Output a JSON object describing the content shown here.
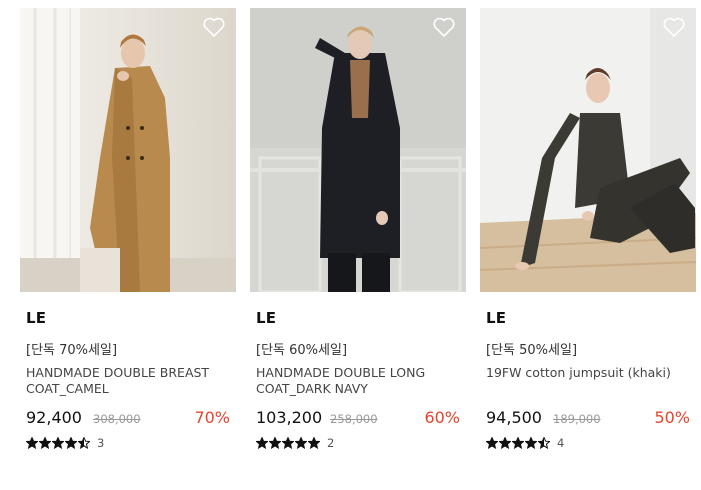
{
  "products": [
    {
      "brand": "LE",
      "promo": "[단독 70%세일]",
      "name_line1": "HANDMADE DOUBLE BREAST",
      "name_line2": "COAT_CAMEL",
      "price": "92,400",
      "original_price": "308,000",
      "discount": "70%",
      "rating": 4.5,
      "review_count": "3",
      "image": "woman-in-camel-coat-photo",
      "wish_icon": "heart-outline-icon"
    },
    {
      "brand": "LE",
      "promo": "[단독 60%세일]",
      "name_line1": "HANDMADE DOUBLE LONG",
      "name_line2": "COAT_DARK NAVY",
      "price": "103,200",
      "original_price": "258,000",
      "discount": "60%",
      "rating": 5,
      "review_count": "2",
      "image": "woman-in-dark-navy-coat-photo",
      "wish_icon": "heart-outline-icon"
    },
    {
      "brand": "LE",
      "promo": "[단독 50%세일]",
      "name_line1": "19FW cotton jumpsuit (khaki)",
      "name_line2": "",
      "price": "94,500",
      "original_price": "189,000",
      "discount": "50%",
      "rating": 4.5,
      "review_count": "4",
      "image": "woman-in-khaki-jumpsuit-photo",
      "wish_icon": "heart-outline-icon"
    }
  ],
  "colors": {
    "discount": "#e8442c",
    "original_price": "#999999",
    "star": "#111111"
  }
}
